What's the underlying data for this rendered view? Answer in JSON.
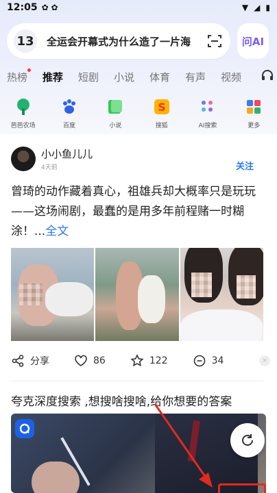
{
  "status": {
    "time": "12:05"
  },
  "search": {
    "rank": "13",
    "query": "全运会开幕式为什么造了一片海"
  },
  "ai_button": {
    "label": "问AI"
  },
  "tabs": [
    "热榜",
    "推荐",
    "短剧",
    "小说",
    "体育",
    "有声",
    "视频"
  ],
  "apps": [
    {
      "label": "芭芭农场",
      "icon": "farm-icon"
    },
    {
      "label": "百度",
      "icon": "baidu-paw-icon"
    },
    {
      "label": "小说",
      "icon": "book-icon"
    },
    {
      "label": "搜狐",
      "icon": "sohu-icon"
    },
    {
      "label": "AI搜索",
      "icon": "ai-search-icon"
    },
    {
      "label": "更多",
      "icon": "more-apps-icon"
    }
  ],
  "post": {
    "author": "小小鱼儿儿",
    "time": "4天前",
    "follow": "关注",
    "text": "曾琦的动作藏着真心，祖雄兵却大概率只是玩玩——这场闹剧，最蠢的是用多年前程赌一时糊涂！...",
    "more": "全文",
    "share": "分享",
    "likes": "86",
    "favorites": "122",
    "comments": "34"
  },
  "post2": {
    "title": "夸克深度搜索 ,想搜啥搜啥,给你想要的答案"
  },
  "colors": {
    "accent": "#2a78f5",
    "ai": "#7b5cf0",
    "annotation": "#e22a1f"
  }
}
